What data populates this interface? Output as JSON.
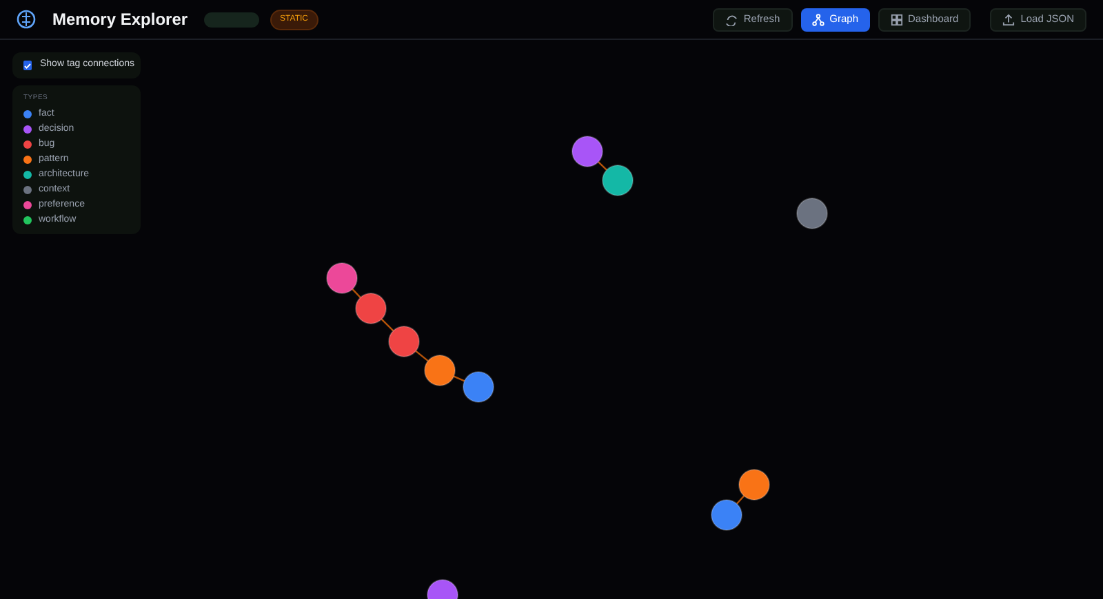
{
  "header": {
    "title": "Memory Explorer",
    "mode_badge": "STATIC",
    "buttons": [
      {
        "label": "Refresh",
        "selected": false
      },
      {
        "label": "Graph",
        "selected": true
      },
      {
        "label": "Dashboard",
        "selected": false
      },
      {
        "label": "Load JSON",
        "selected": false
      }
    ]
  },
  "options": {
    "label": "Show tag connections",
    "checked": true
  },
  "legend": {
    "title": "TYPES",
    "types": [
      {
        "label": "fact",
        "color": "#3b82f6"
      },
      {
        "label": "decision",
        "color": "#a855f7"
      },
      {
        "label": "bug",
        "color": "#ef4444"
      },
      {
        "label": "pattern",
        "color": "#f97316"
      },
      {
        "label": "architecture",
        "color": "#14b8a6"
      },
      {
        "label": "context",
        "color": "#6b7280"
      },
      {
        "label": "preference",
        "color": "#ec4899"
      },
      {
        "label": "workflow",
        "color": "#22c55e"
      }
    ]
  },
  "graph": {
    "nodes": [
      {
        "color": "#ec4899"
      },
      {
        "color": "#ef4444"
      },
      {
        "color": "#ef4444"
      },
      {
        "color": "#f97316"
      },
      {
        "color": "#3b82f6"
      },
      {
        "color": "#a855f7"
      },
      {
        "color": "#14b8a6"
      },
      {
        "color": "#6b7280"
      },
      {
        "color": "#f97316"
      },
      {
        "color": "#3b82f6"
      },
      {
        "color": "#a855f7"
      }
    ]
  }
}
